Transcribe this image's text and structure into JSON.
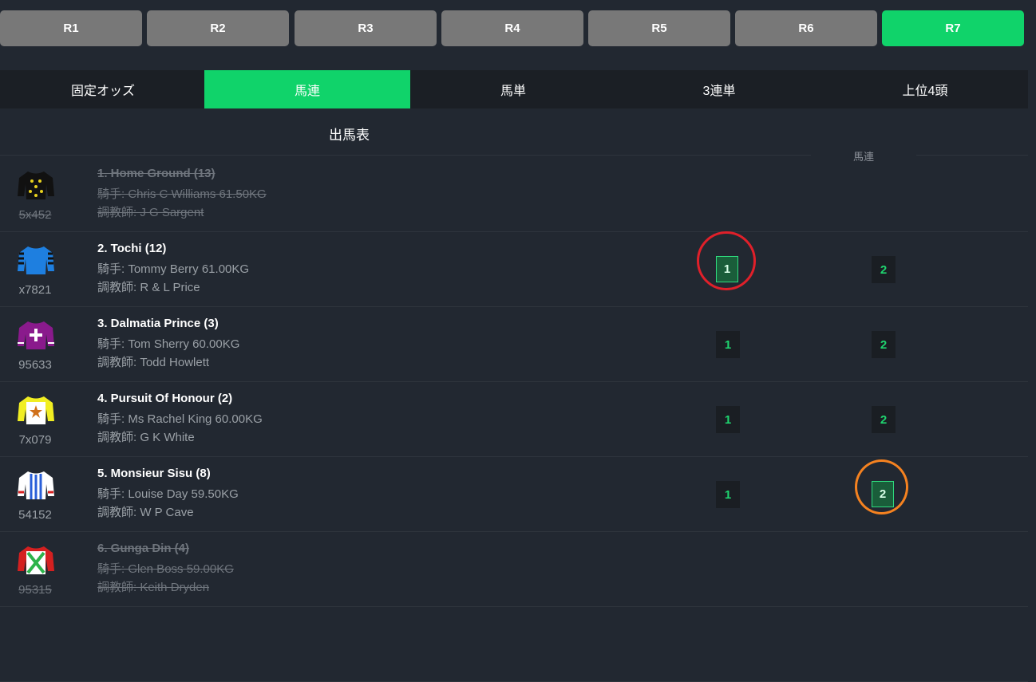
{
  "races": [
    "R1",
    "R2",
    "R3",
    "R4",
    "R5",
    "R6",
    "R7"
  ],
  "active_race": "R7",
  "tabs": [
    "固定オッズ",
    "馬連",
    "馬単",
    "3連単",
    "上位4頭"
  ],
  "active_tab": "馬連",
  "table": {
    "title": "出馬表",
    "col_label": "馬連",
    "rows": [
      {
        "name": "1. Home Ground (13)",
        "jockey": "騎手: Chris C Williams 61.50KG",
        "trainer": "調教師: J G Sargent",
        "code": "5x452",
        "scratched": true,
        "silk": "black-yellow-spots"
      },
      {
        "name": "2. Tochi (12)",
        "jockey": "騎手: Tommy Berry 61.00KG",
        "trainer": "調教師: R & L Price",
        "code": "x7821",
        "scratched": false,
        "pick1": "1",
        "pick2": "2",
        "selected1": true,
        "selected2": false,
        "silk": "blue-black"
      },
      {
        "name": "3. Dalmatia Prince (3)",
        "jockey": "騎手: Tom Sherry 60.00KG",
        "trainer": "調教師: Todd Howlett",
        "code": "95633",
        "scratched": false,
        "pick1": "1",
        "pick2": "2",
        "selected1": false,
        "selected2": false,
        "silk": "purple-white-cross"
      },
      {
        "name": "4. Pursuit Of Honour (2)",
        "jockey": "騎手: Ms Rachel King 60.00KG",
        "trainer": "調教師: G K White",
        "code": "7x079",
        "scratched": false,
        "pick1": "1",
        "pick2": "2",
        "selected1": false,
        "selected2": false,
        "silk": "yellow-white-star"
      },
      {
        "name": "5. Monsieur Sisu (8)",
        "jockey": "騎手: Louise Day 59.50KG",
        "trainer": "調教師: W P Cave",
        "code": "54152",
        "scratched": false,
        "pick1": "1",
        "pick2": "2",
        "selected1": false,
        "selected2": true,
        "silk": "blue-white-stripes"
      },
      {
        "name": "6. Gunga Din (4)",
        "jockey": "騎手: Glen Boss 59.00KG",
        "trainer": "調教師: Keith Dryden",
        "code": "95315",
        "scratched": true,
        "silk": "red-white-green"
      }
    ]
  },
  "colors": {
    "accent": "#10d36a",
    "background": "#222831",
    "tab_bar": "#1b1f25",
    "race_button": "#787878",
    "annotation_red": "#e0202a",
    "annotation_orange": "#f58220"
  }
}
